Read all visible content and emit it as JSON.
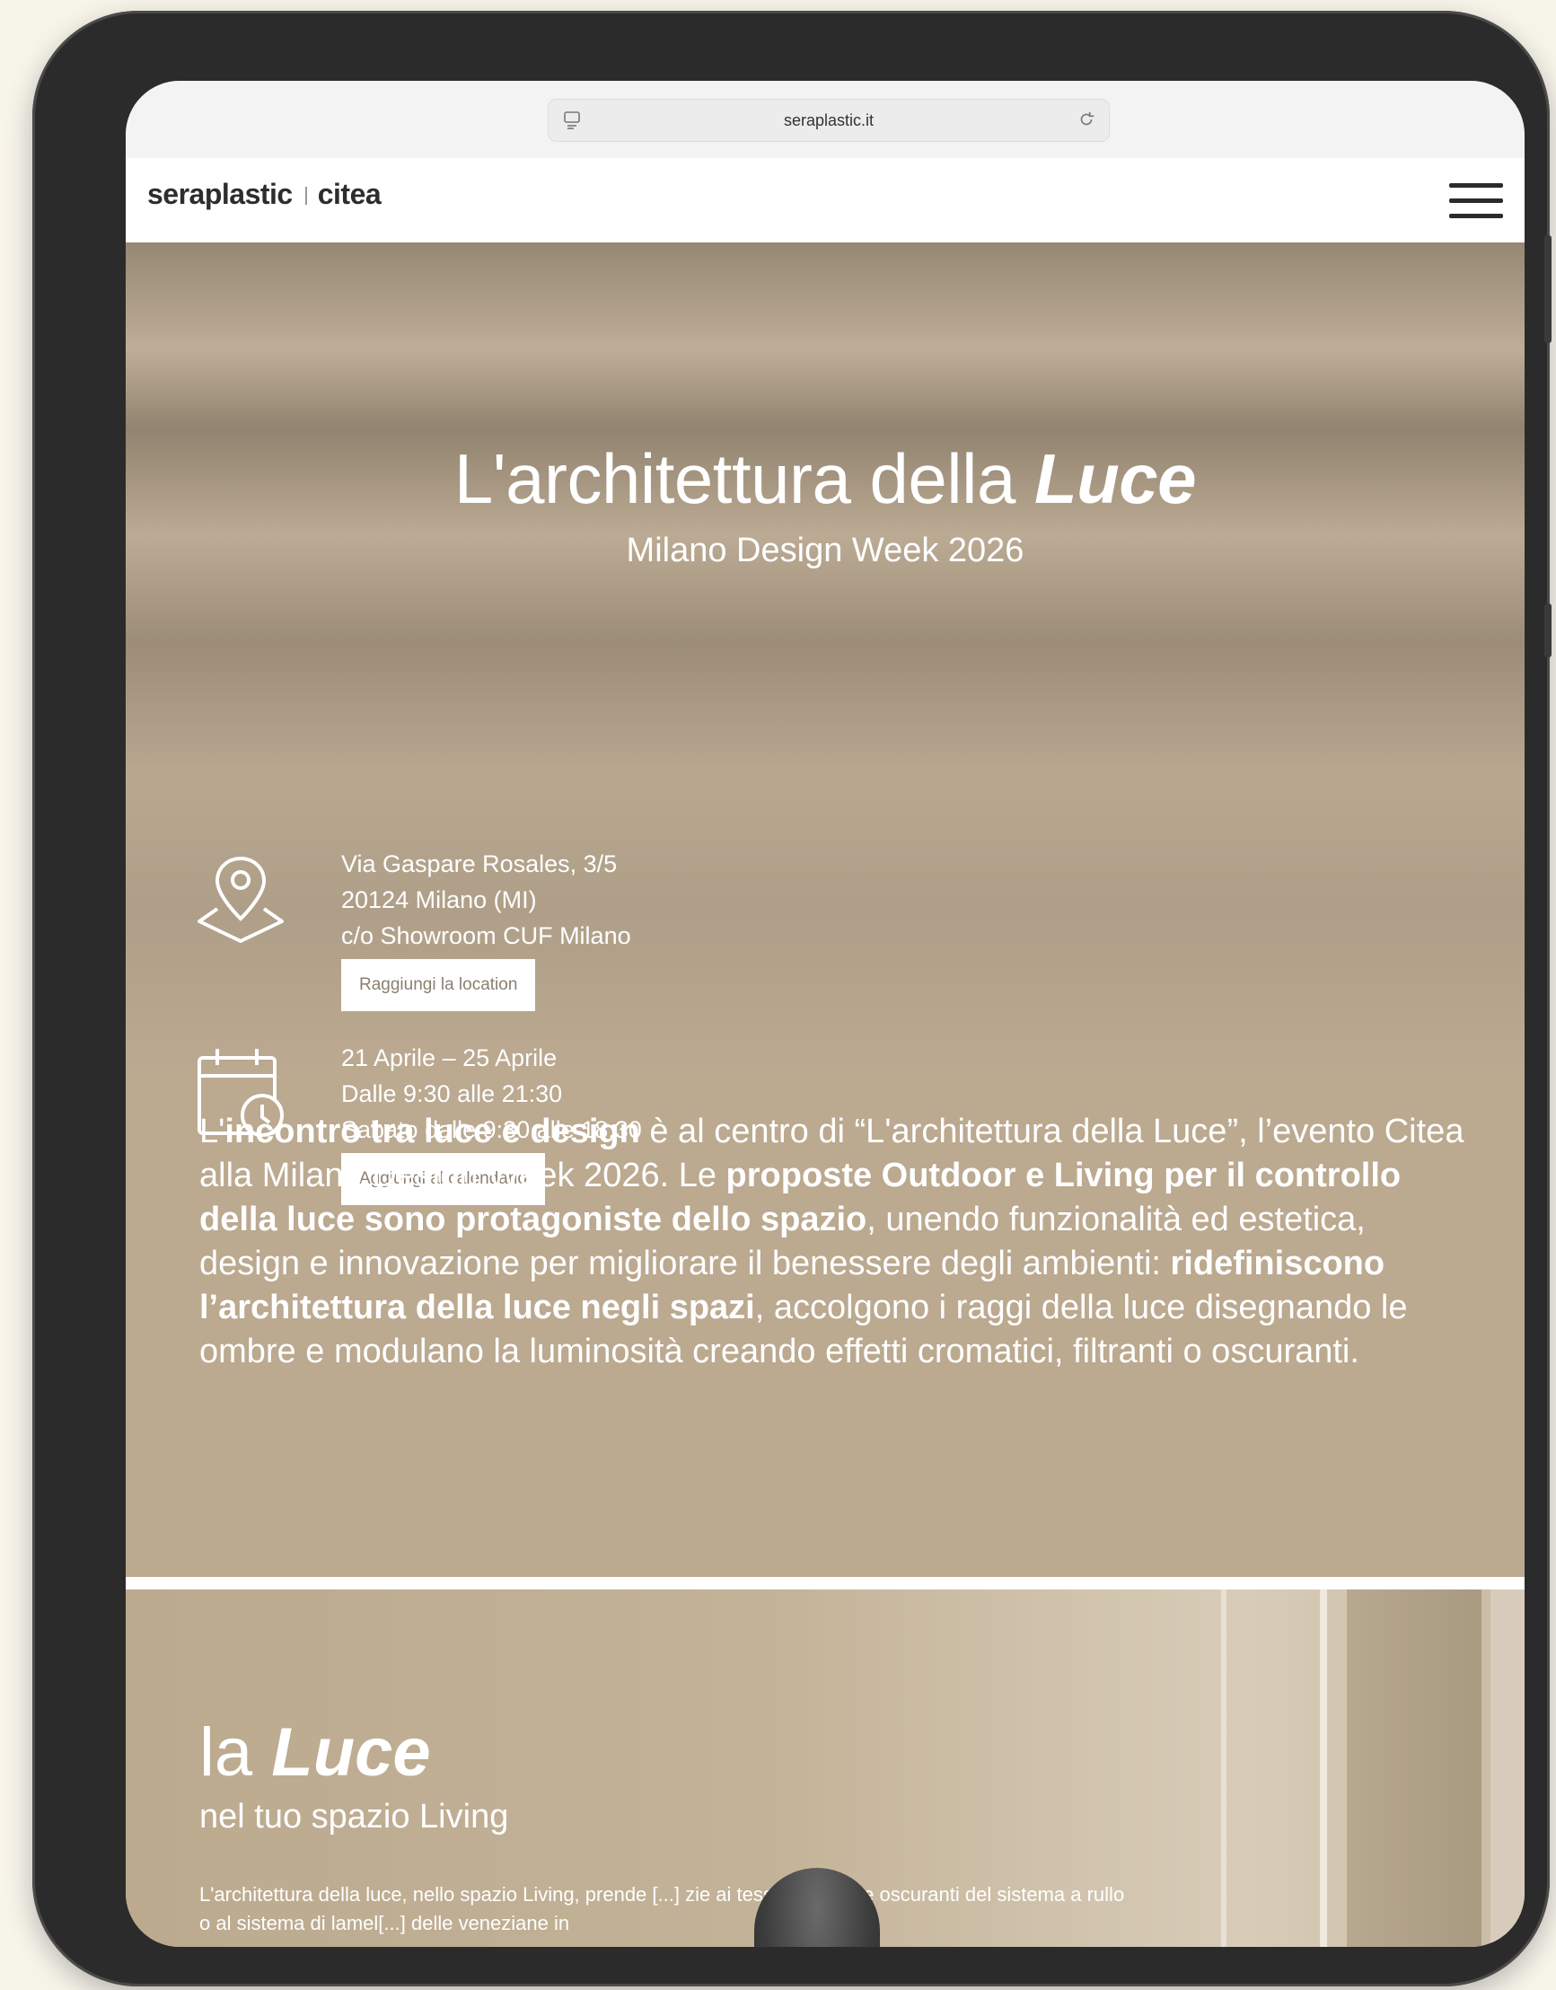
{
  "browser": {
    "url": "seraplastic.it"
  },
  "nav": {
    "logo_primary": "seraplastic",
    "logo_secondary": "citea"
  },
  "hero": {
    "title_regular": "L'architettura della ",
    "title_emphasis": "Luce",
    "subtitle": "Milano Design Week 2026"
  },
  "location": {
    "lines": [
      "Via Gaspare Rosales, 3/5",
      "20124 Milano (MI)",
      "c/o Showroom CUF Milano"
    ],
    "button_label": "Raggiungi la location"
  },
  "schedule": {
    "lines": [
      "21 Aprile – 25 Aprile",
      "Dalle 9:30 alle 21:30",
      "Sabato dalle 9:30 alle 18:30"
    ],
    "button_label": "Aggiungi al calendario"
  },
  "intro": {
    "segments": [
      {
        "text": "L'",
        "bold": false
      },
      {
        "text": "incontro tra luce e design",
        "bold": true
      },
      {
        "text": " è al centro di “L'architettura della Luce”, l’evento Citea alla Milano Design Week 2026. Le ",
        "bold": false
      },
      {
        "text": "proposte Outdoor e Living per il controllo della luce sono protagoniste dello spazio",
        "bold": true
      },
      {
        "text": ", unendo funzionalità ed estetica, design e innovazione per migliorare il benessere degli ambienti: ",
        "bold": false
      },
      {
        "text": "ridefiniscono l’architettura della luce negli spazi",
        "bold": true
      },
      {
        "text": ", accolgono i raggi della luce disegnando le ombre e modulano la luminosità creando effetti cromatici, filtranti o oscuranti.",
        "bold": false
      }
    ]
  },
  "living": {
    "title_regular": "la ",
    "title_emphasis": "Luce",
    "subtitle": "nel tuo spazio Living",
    "paragraph": "L'architettura della luce, nello spazio Living, prende [...] zie ai tessuti filtranti e oscuranti del sistema a rullo o al sistema di lamel[...] delle veneziane in"
  },
  "icons": {
    "url_left": "reader-icon",
    "url_right": "reload-icon",
    "menu": "hamburger-menu-icon",
    "location": "map-pin-icon",
    "schedule": "calendar-clock-icon"
  }
}
